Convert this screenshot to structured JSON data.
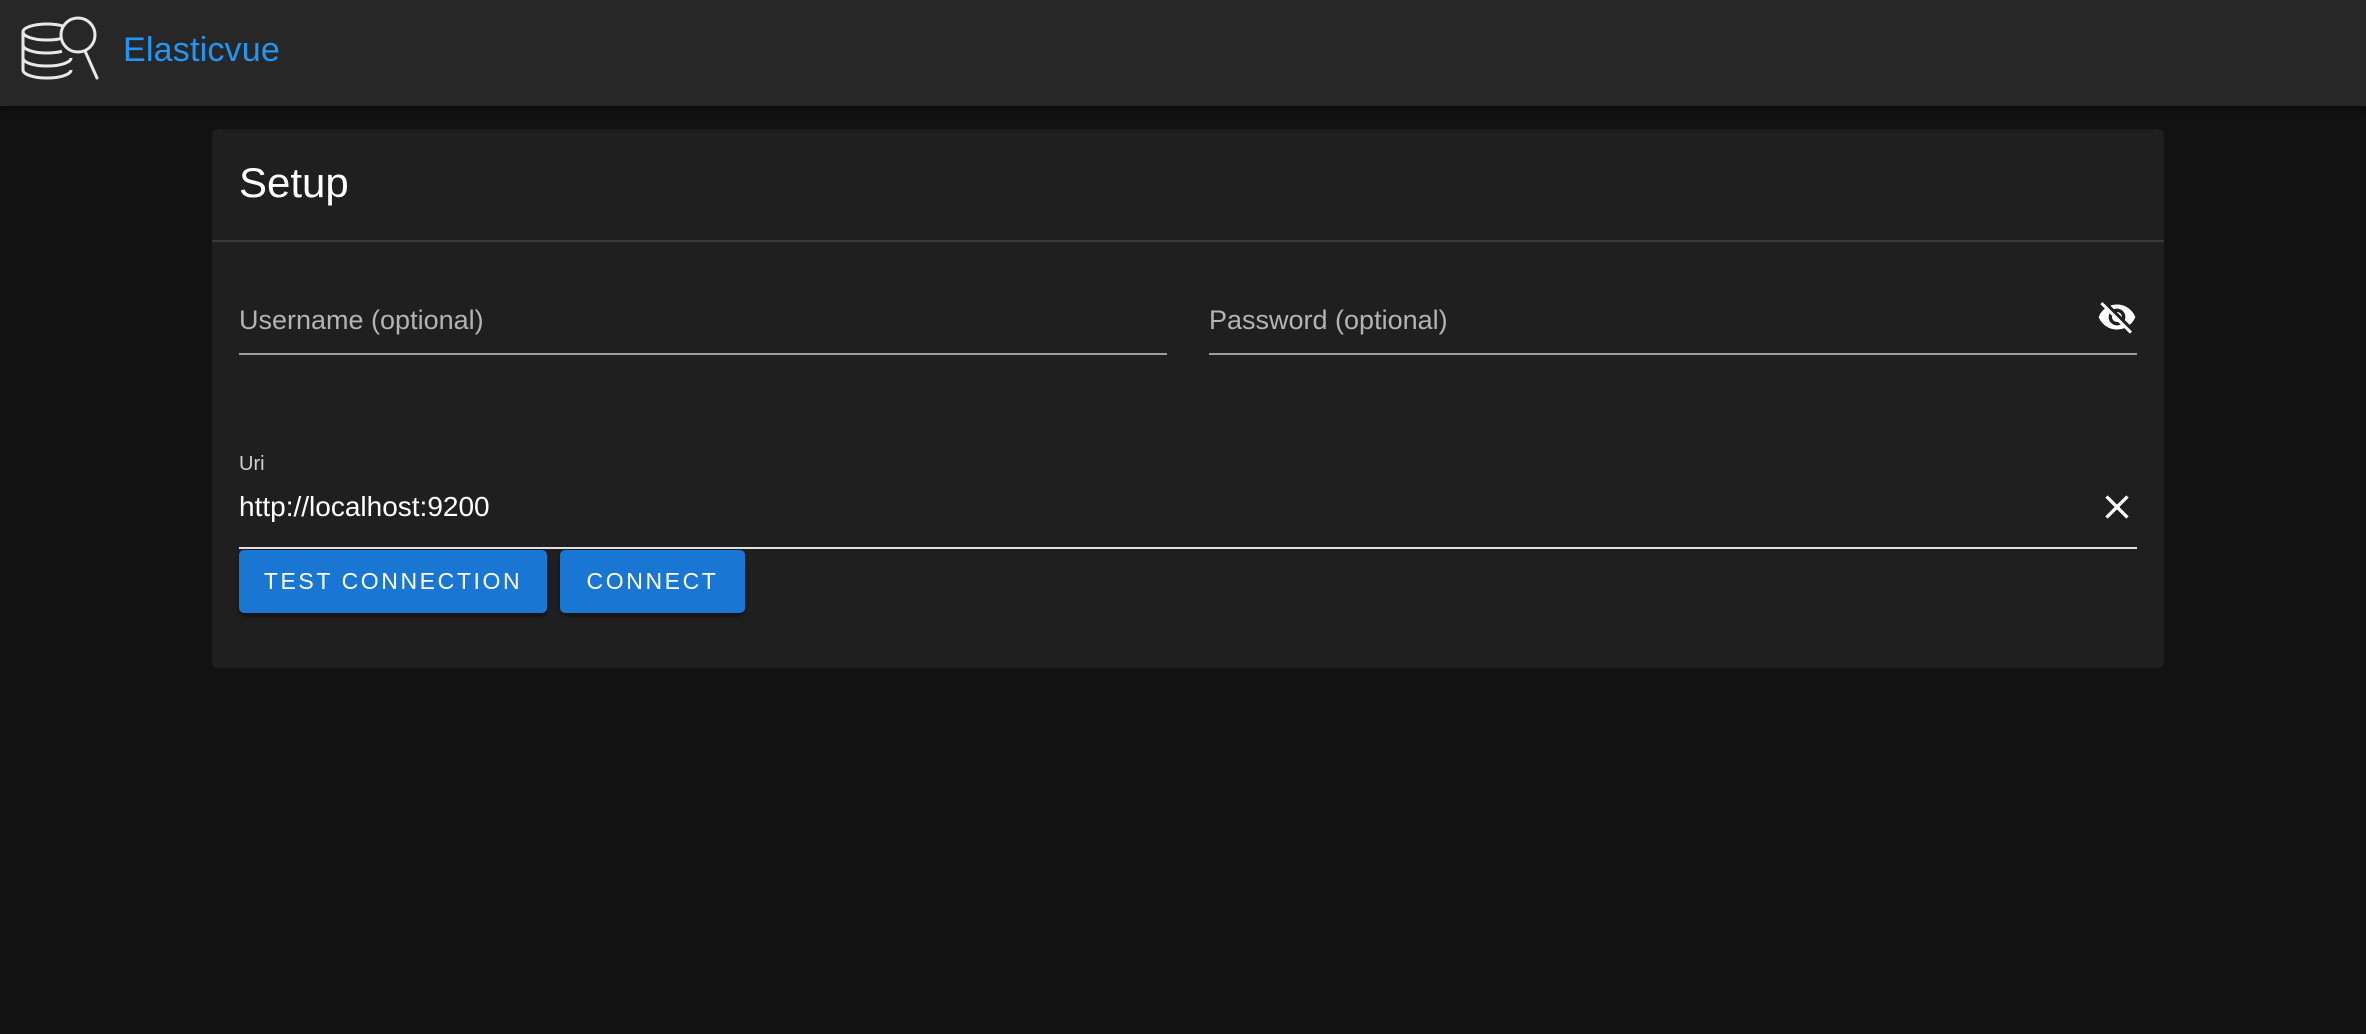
{
  "app_bar": {
    "logo_icon": "database-search-icon",
    "title": "Elasticvue",
    "title_color": "#2196f3"
  },
  "setup": {
    "title": "Setup",
    "username": {
      "placeholder": "Username (optional)",
      "value": ""
    },
    "password": {
      "placeholder": "Password (optional)",
      "value": "",
      "toggle_icon": "eye-off-icon"
    },
    "uri": {
      "label": "Uri",
      "value": "http://localhost:9200",
      "clear_icon": "close-icon"
    },
    "buttons": {
      "test_connection": "TEST CONNECTION",
      "connect": "CONNECT"
    },
    "accent_color": "#1976d2"
  }
}
